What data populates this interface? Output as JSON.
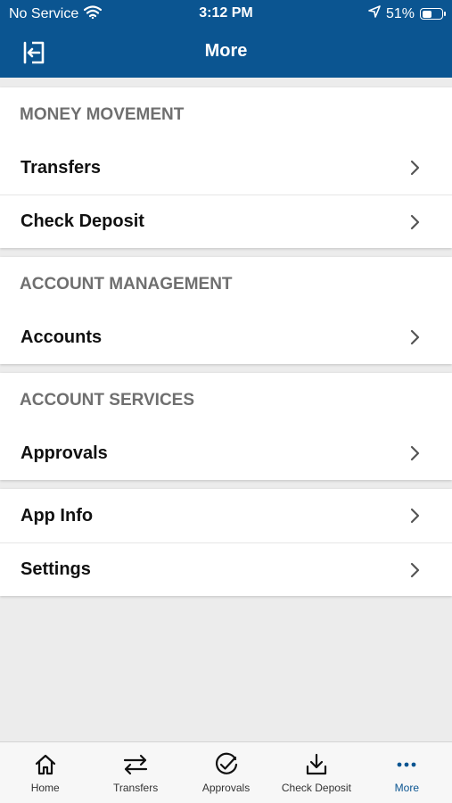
{
  "status_bar": {
    "carrier": "No Service",
    "time": "3:12 PM",
    "battery": "51%",
    "battery_level": 0.51,
    "icons": [
      "wifi-icon",
      "location-arrow-icon",
      "battery-icon"
    ]
  },
  "header": {
    "title": "More",
    "logout_icon": "logout-icon",
    "background_color": "#0b5591"
  },
  "sections": {
    "money_movement": {
      "title": "MONEY MOVEMENT",
      "items": [
        "Transfers",
        "Check Deposit"
      ]
    },
    "account_management": {
      "title": "ACCOUNT MANAGEMENT",
      "items": [
        "Accounts"
      ]
    },
    "account_services": {
      "title": "ACCOUNT SERVICES",
      "items": [
        "Approvals"
      ]
    },
    "misc": {
      "items": [
        "App Info",
        "Settings"
      ]
    }
  },
  "tab_bar": {
    "items": [
      {
        "label": "Home",
        "icon": "home-icon"
      },
      {
        "label": "Transfers",
        "icon": "transfer-arrows-icon"
      },
      {
        "label": "Approvals",
        "icon": "check-circle-icon"
      },
      {
        "label": "Check Deposit",
        "icon": "download-tray-icon"
      },
      {
        "label": "More",
        "icon": "more-dots-icon"
      }
    ],
    "active": "More",
    "active_color": "#0b5591"
  }
}
